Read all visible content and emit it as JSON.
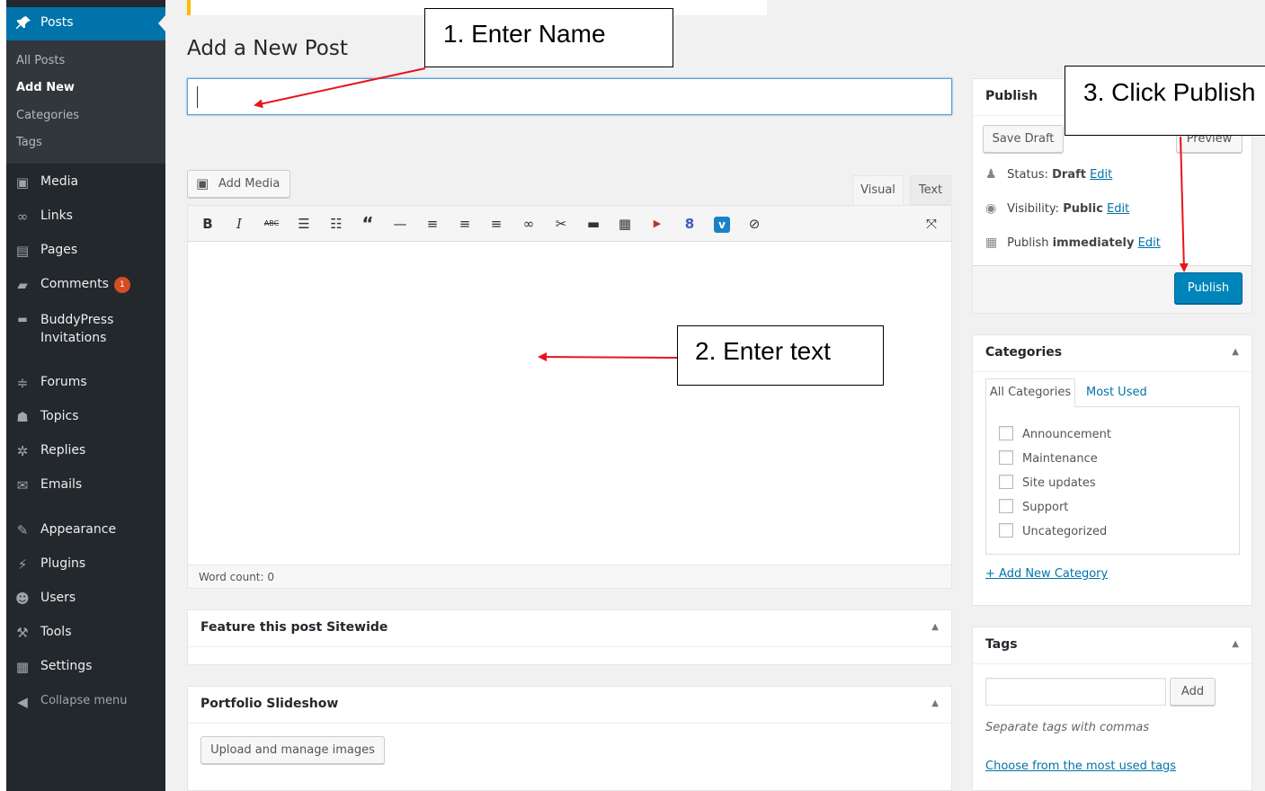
{
  "sidebar": {
    "posts_label": "Posts",
    "submenu": [
      "All Posts",
      "Add New",
      "Categories",
      "Tags"
    ],
    "items": [
      {
        "label": "Media",
        "icon": "media-icon"
      },
      {
        "label": "Links",
        "icon": "link-icon"
      },
      {
        "label": "Pages",
        "icon": "pages-icon"
      },
      {
        "label": "Comments",
        "icon": "comments-icon",
        "badge": "1"
      },
      {
        "label": "BuddyPress Invitations",
        "line1": "BuddyPress",
        "line2": "Invitations",
        "icon": "invitations-icon"
      },
      {
        "label": "Forums",
        "icon": "forums-icon"
      },
      {
        "label": "Topics",
        "icon": "topics-icon"
      },
      {
        "label": "Replies",
        "icon": "replies-icon"
      },
      {
        "label": "Emails",
        "icon": "email-icon"
      },
      {
        "label": "Appearance",
        "icon": "appearance-icon"
      },
      {
        "label": "Plugins",
        "icon": "plugins-icon"
      },
      {
        "label": "Users",
        "icon": "users-icon"
      },
      {
        "label": "Tools",
        "icon": "tools-icon"
      },
      {
        "label": "Settings",
        "icon": "settings-icon"
      }
    ],
    "collapse_label": "Collapse menu"
  },
  "main": {
    "page_title": "Add a New Post",
    "title_input_value": "",
    "add_media_label": "Add Media",
    "editor_tabs": {
      "visual": "Visual",
      "text": "Text"
    },
    "word_count": "Word count: 0",
    "metaboxes": {
      "feature": "Feature this post Sitewide",
      "portfolio": "Portfolio Slideshow",
      "upload_button": "Upload and manage images"
    }
  },
  "publish": {
    "title": "Publish",
    "save_draft": "Save Draft",
    "preview": "Preview",
    "status_label": "Status:",
    "status_value": "Draft",
    "visibility_label": "Visibility:",
    "visibility_value": "Public",
    "publish_label": "Publish",
    "publish_value": "immediately",
    "edit_link": "Edit",
    "publish_button": "Publish"
  },
  "categories": {
    "title": "Categories",
    "tab_all": "All Categories",
    "tab_most_used": "Most Used",
    "items": [
      "Announcement",
      "Maintenance",
      "Site updates",
      "Support",
      "Uncategorized"
    ],
    "add_new": "+ Add New Category"
  },
  "tags": {
    "title": "Tags",
    "add_button": "Add",
    "hint": "Separate tags with commas",
    "choose_link": "Choose from the most used tags"
  },
  "annotations": {
    "step1": "1. Enter Name",
    "step2": "2. Enter text",
    "step3": "3. Click Publish",
    "arrow_color": "#e8141c"
  },
  "colors": {
    "sidebar_bg": "#23282d",
    "sidebar_sub_bg": "#32373c",
    "accent": "#0073aa",
    "primary_button": "#0085ba",
    "badge": "#d54e21",
    "notice_border": "#ffb900"
  }
}
